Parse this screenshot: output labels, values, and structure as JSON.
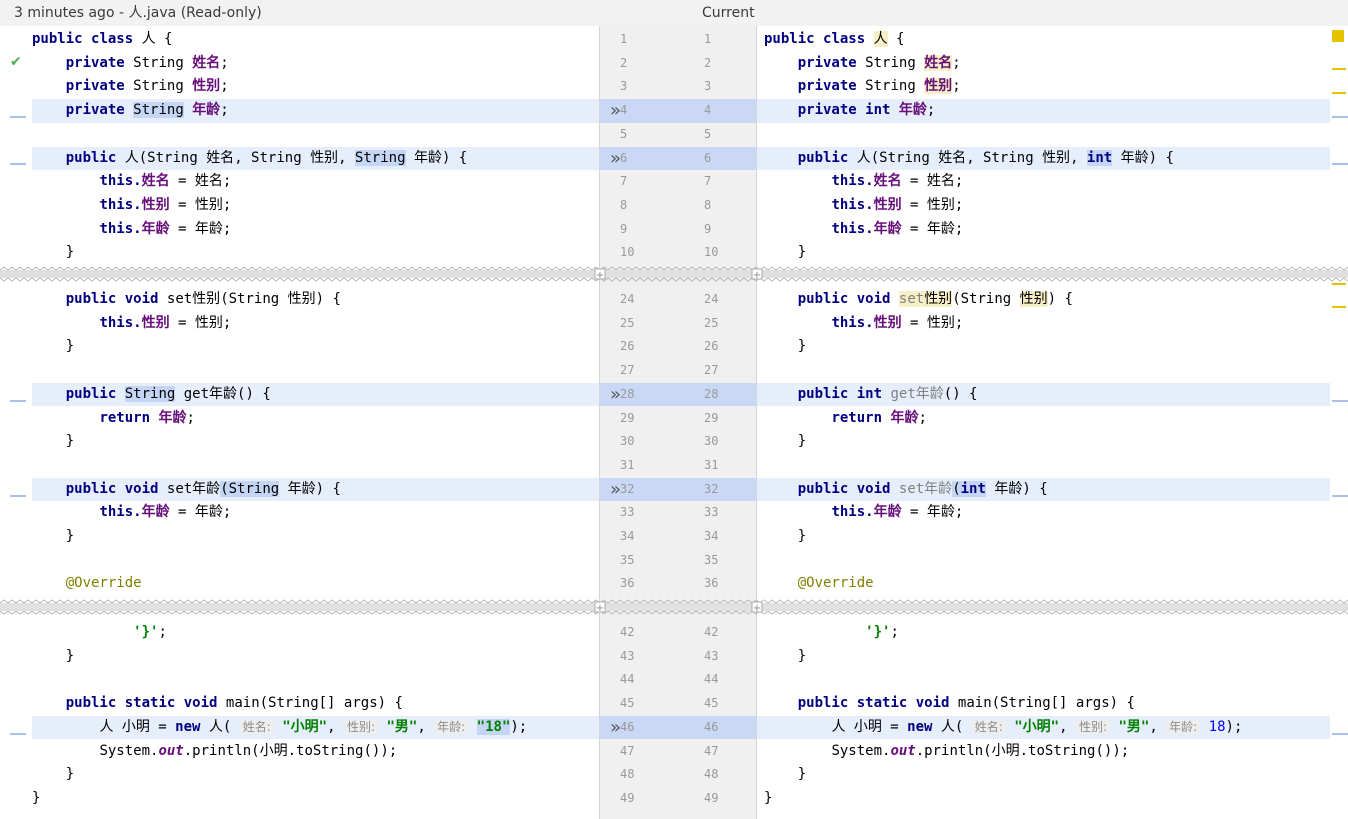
{
  "header": {
    "left_title": "3 minutes ago - 人.java (Read-only)",
    "right_title": "Current"
  },
  "icons": {
    "status": "check-icon",
    "apply_change": "double-chevron-right-icon"
  },
  "line_numbers": {
    "left": [
      "1",
      "2",
      "3",
      "4",
      "5",
      "6",
      "7",
      "8",
      "9",
      "10",
      "24",
      "25",
      "26",
      "27",
      "28",
      "29",
      "30",
      "31",
      "32",
      "33",
      "34",
      "35",
      "36",
      "42",
      "43",
      "44",
      "45",
      "46",
      "47",
      "48",
      "49"
    ],
    "right": [
      "1",
      "2",
      "3",
      "4",
      "5",
      "6",
      "7",
      "8",
      "9",
      "10",
      "24",
      "25",
      "26",
      "27",
      "28",
      "29",
      "30",
      "31",
      "32",
      "33",
      "34",
      "35",
      "36",
      "42",
      "43",
      "44",
      "45",
      "46",
      "47",
      "48",
      "49"
    ]
  },
  "code": {
    "public": "public",
    "class": "class",
    "private": "private",
    "void": "void",
    "static": "static",
    "return": "return",
    "new": "new",
    "this": "this.",
    "int": "int",
    "String": "String",
    "cls": "人",
    "name": "姓名",
    "gender": "性别",
    "age": "年龄",
    "set_gender": "set性别",
    "get_age": "get年龄",
    "set_age": "set年龄",
    "set": "set",
    "override": "@Override",
    "brace_str": "'}'",
    "main": "main",
    "args": "(String[] args) {",
    "xiaoming": "小明",
    "out": "out",
    "sys": "System.",
    "println": ".println(小明.toString());",
    "hint_name": "姓名:",
    "hint_gender": "性别:",
    "hint_age": "年龄:",
    "str_name": "\"小明\"",
    "str_gender": "\"男\"",
    "str_age": "\"18\"",
    "num_age": "18"
  }
}
